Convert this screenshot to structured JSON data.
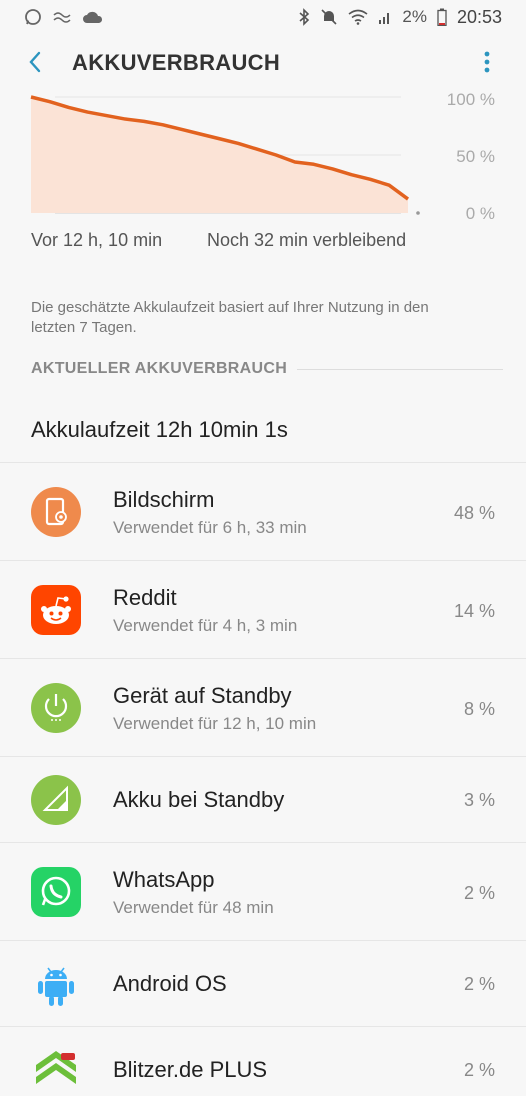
{
  "status_bar": {
    "battery_percent": "2%",
    "time": "20:53"
  },
  "appbar": {
    "title": "AKKUVERBRAUCH"
  },
  "chart_data": {
    "type": "area",
    "y_tick_labels": [
      "100 %",
      "50 %",
      "0 %"
    ],
    "ylim": [
      0,
      100
    ],
    "x_start_label": "Vor 12 h, 10 min",
    "x_end_label": "Noch 32 min verbleibend",
    "x": [
      0,
      0.05,
      0.1,
      0.15,
      0.2,
      0.25,
      0.3,
      0.35,
      0.4,
      0.45,
      0.5,
      0.55,
      0.6,
      0.65,
      0.7,
      0.75,
      0.8,
      0.85,
      0.9,
      0.95,
      1.0
    ],
    "values": [
      100,
      96,
      91,
      87,
      84,
      81,
      79,
      76,
      72,
      68,
      64,
      60,
      55,
      50,
      44,
      42,
      38,
      33,
      29,
      24,
      12
    ],
    "line_color": "#e2621f",
    "fill_color": "#fbe3d6",
    "grid": true
  },
  "note": "Die geschätzte Akkulaufzeit basiert auf Ihrer Nutzung in den letzten 7 Tagen.",
  "section_title": "AKTUELLER AKKUVERBRAUCH",
  "total": "Akkulaufzeit 12h 10min 1s",
  "items": [
    {
      "name": "Bildschirm",
      "sub": "Verwendet für 6 h, 33 min",
      "pct": "48 %",
      "icon": "screen-icon",
      "color": "#ef8a4c"
    },
    {
      "name": "Reddit",
      "sub": "Verwendet für 4 h, 3 min",
      "pct": "14 %",
      "icon": "reddit-icon",
      "color": "#ff4500"
    },
    {
      "name": "Gerät auf Standby",
      "sub": "Verwendet für 12 h, 10 min",
      "pct": "8 %",
      "icon": "power-icon",
      "color": "#8bc34a"
    },
    {
      "name": "Akku bei Standby",
      "sub": "",
      "pct": "3 %",
      "icon": "signal-icon",
      "color": "#8bc34a"
    },
    {
      "name": "WhatsApp",
      "sub": "Verwendet für 48 min",
      "pct": "2 %",
      "icon": "whatsapp-icon",
      "color": "#25d366"
    },
    {
      "name": "Android OS",
      "sub": "",
      "pct": "2 %",
      "icon": "android-icon",
      "color": "#3daef5"
    },
    {
      "name": "Blitzer.de PLUS",
      "sub": "",
      "pct": "2 %",
      "icon": "blitzer-icon",
      "color": "#6cbf3a"
    }
  ]
}
